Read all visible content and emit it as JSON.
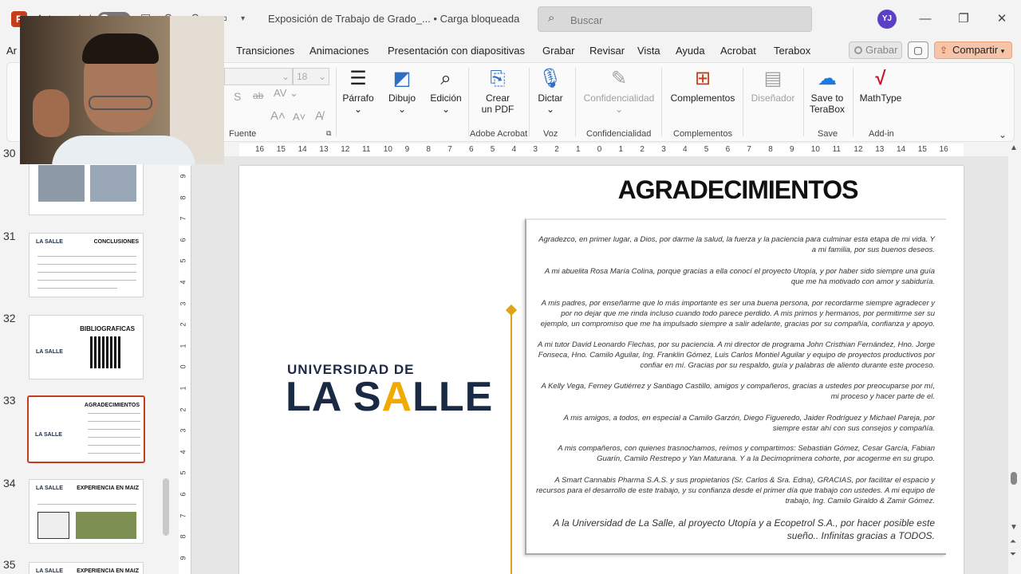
{
  "titlebar": {
    "autosave_label": "Autoguardado",
    "doc_title": "Exposición de Trabajo de Grado_...  •  Carga bloqueada",
    "search_placeholder": "Buscar",
    "user_initials": "YJ"
  },
  "tabs": [
    "Ar",
    "Transiciones",
    "Animaciones",
    "Presentación con diapositivas",
    "Grabar",
    "Revisar",
    "Vista",
    "Ayuda",
    "Acrobat",
    "Terabox"
  ],
  "actions": {
    "record": "Grabar",
    "share": "Compartir"
  },
  "ribbon": {
    "font_size": "18",
    "groups": {
      "fuente": "Fuente",
      "adobe": "Adobe Acrobat",
      "voz": "Voz",
      "conf": "Confidencialidad",
      "compl": "Complementos",
      "save": "Save",
      "addin": "Add-in"
    },
    "buttons": {
      "parrafo": "Párrafo",
      "dibujo": "Dibujo",
      "edicion": "Edición",
      "crear_pdf_1": "Crear",
      "crear_pdf_2": "un PDF",
      "dictar": "Dictar",
      "confidencialidad": "Confidencialidad",
      "complementos": "Complementos",
      "disenador": "Diseñador",
      "save_terabox_1": "Save to",
      "save_terabox_2": "TeraBox",
      "mathtype": "MathType"
    }
  },
  "slides": [
    {
      "num": "30"
    },
    {
      "num": "31",
      "title": "CONCLUSIONES"
    },
    {
      "num": "32",
      "title": "BIBLIOGRAFICAS"
    },
    {
      "num": "33",
      "title": "AGRADECIMIENTOS"
    },
    {
      "num": "34",
      "title": "EXPERIENCIA EN MAIZ"
    },
    {
      "num": "35",
      "title": "EXPERIENCIA EN MAIZ"
    }
  ],
  "thumb_logo": "LA SALLE",
  "hruler": [
    "16",
    "15",
    "14",
    "13",
    "12",
    "11",
    "10",
    "9",
    "8",
    "7",
    "6",
    "5",
    "4",
    "3",
    "2",
    "1",
    "0",
    "1",
    "2",
    "3",
    "4",
    "5",
    "6",
    "7",
    "8",
    "9",
    "10",
    "11",
    "12",
    "13",
    "14",
    "15",
    "16"
  ],
  "vruler": [
    "9",
    "8",
    "7",
    "6",
    "5",
    "4",
    "3",
    "2",
    "1",
    "0",
    "1",
    "2",
    "3",
    "4",
    "5",
    "6",
    "7",
    "8",
    "9"
  ],
  "slide": {
    "title": "AGRADECIMIENTOS",
    "uni_top": "UNIVERSIDAD DE",
    "uni_main_a": "LA S",
    "uni_main_accent": "A",
    "uni_main_b": "LLE",
    "paragraphs": [
      "Agradezco, en primer lugar, a Dios, por darme la salud, la fuerza y la paciencia para culminar esta etapa de mi vida. Y a mi familia, por sus buenos deseos.",
      "A mi abuelita Rosa María Colina, porque gracias a ella conocí el proyecto Utopía, y por haber sido siempre una guía que me ha motivado con amor y sabiduría.",
      "A mis padres, por enseñarme que lo más importante es ser una buena persona, por recordarme siempre agradecer y por no dejar que me rinda incluso cuando todo parece perdido. A mis primos y hermanos, por permitirme ser su ejemplo, un compromiso que me ha impulsado siempre a salir adelante, gracias por su compañía, confianza y apoyo.",
      "A mi tutor David Leonardo Flechas, por su paciencia. A mi director de programa John Cristhian Fernández, Hno. Jorge Fonseca, Hno. Camilo Aguilar, Ing. Franklin Gómez, Luis Carlos Montiel Aguilar y equipo de proyectos productivos por confiar en mí. Gracias por su respaldo, guía y palabras de aliento durante este proceso.",
      "A Kelly Vega, Ferney Gutiérrez y Santiago Castillo, amigos y compañeros, gracias a ustedes por preocuparse por mí, mi proceso y hacer parte de el.",
      "A mis amigos, a todos, en especial a Camilo Garzón, Diego Figueredo, Jaider Rodríguez y Michael Pareja, por siempre estar ahí con sus consejos y compañía.",
      "A mis compañeros, con quienes trasnochamos, reímos y compartimos: Sebastián Gómez, Cesar García, Fabian Guarín, Camilo Restrepo y Yan Maturana. Y a la Decimoprimera cohorte, por acogerme en su grupo.",
      "A Smart Cannabis Pharma S.A.S. y sus propietarios (Sr. Carlos & Sra. Edna), GRACIAS, por facilitar el espacio y recursos para el desarrollo de este trabajo, y su confianza desde el primer día que trabajo con ustedes. A mi equipo de trabajo, Ing. Camilo Giraldo & Zamir Gómez.",
      "A la Universidad de La Salle, al proyecto Utopía y a Ecopetrol S.A., por hacer posible este sueño.. Infinitas gracias a TODOS."
    ]
  },
  "colors": {
    "accent": "#c43e1c",
    "brand_navy": "#1b2a44",
    "brand_gold": "#f2a900"
  }
}
